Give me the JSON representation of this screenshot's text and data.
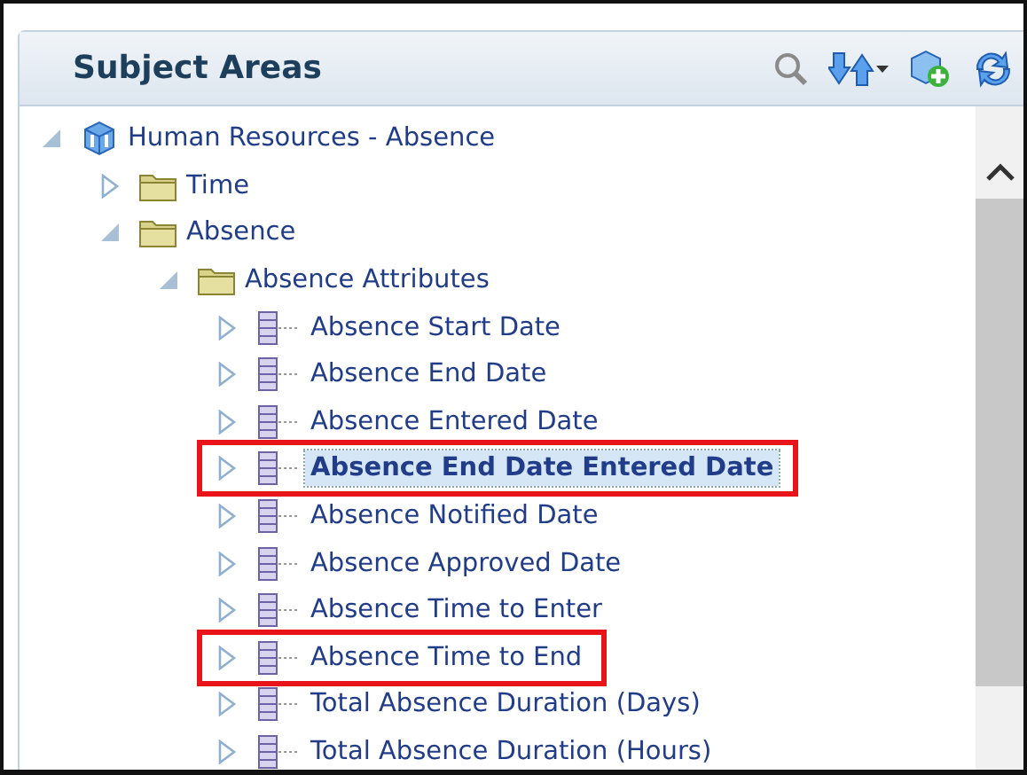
{
  "panel": {
    "title": "Subject Areas"
  },
  "tree": [
    {
      "kind": "subject-area",
      "label": "Human Resources - Absence",
      "expanded": true,
      "selected": false,
      "highlighted": false,
      "children": [
        {
          "kind": "folder",
          "label": "Time",
          "expanded": false,
          "selected": false,
          "highlighted": false
        },
        {
          "kind": "folder",
          "label": "Absence",
          "expanded": true,
          "selected": false,
          "highlighted": false,
          "children": [
            {
              "kind": "folder",
              "label": "Absence Attributes",
              "expanded": true,
              "selected": false,
              "highlighted": false,
              "children": [
                {
                  "kind": "column",
                  "label": "Absence Start Date",
                  "expanded": false,
                  "selected": false,
                  "highlighted": false
                },
                {
                  "kind": "column",
                  "label": "Absence End Date",
                  "expanded": false,
                  "selected": false,
                  "highlighted": false
                },
                {
                  "kind": "column",
                  "label": "Absence Entered Date",
                  "expanded": false,
                  "selected": false,
                  "highlighted": false
                },
                {
                  "kind": "column",
                  "label": "Absence End Date Entered Date",
                  "expanded": false,
                  "selected": true,
                  "highlighted": true
                },
                {
                  "kind": "column",
                  "label": "Absence Notified Date",
                  "expanded": false,
                  "selected": false,
                  "highlighted": false
                },
                {
                  "kind": "column",
                  "label": "Absence Approved Date",
                  "expanded": false,
                  "selected": false,
                  "highlighted": false
                },
                {
                  "kind": "column",
                  "label": "Absence Time to Enter",
                  "expanded": false,
                  "selected": false,
                  "highlighted": false
                },
                {
                  "kind": "column",
                  "label": "Absence Time to End",
                  "expanded": false,
                  "selected": false,
                  "highlighted": true
                },
                {
                  "kind": "column",
                  "label": "Total Absence Duration (Days)",
                  "expanded": false,
                  "selected": false,
                  "highlighted": false
                },
                {
                  "kind": "column",
                  "label": "Total Absence Duration (Hours)",
                  "expanded": false,
                  "selected": false,
                  "highlighted": false
                }
              ]
            }
          ]
        }
      ]
    }
  ]
}
